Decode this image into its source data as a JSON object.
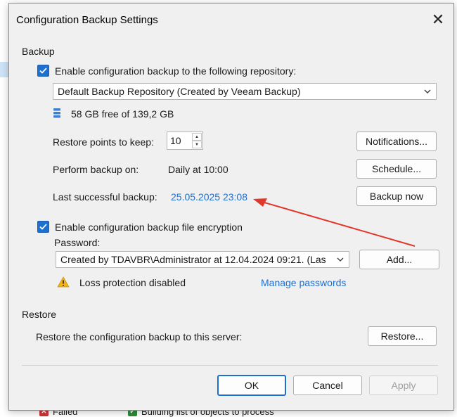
{
  "background": {
    "status_items": [
      {
        "label": "Failed",
        "icon": "error-icon",
        "color": "#d13438"
      },
      {
        "label": "Building list of objects to process",
        "icon": "success-icon",
        "color": "#2e8b3a"
      }
    ]
  },
  "dialog": {
    "title": "Configuration Backup Settings",
    "close_glyph": "✕",
    "backup": {
      "section_label": "Backup",
      "enable_backup_label": "Enable configuration backup to the following repository:",
      "enable_backup_checked": true,
      "repository": "Default Backup Repository (Created by Veeam Backup)",
      "storage_info": "58 GB free of 139,2 GB",
      "restore_points_label": "Restore points to keep:",
      "restore_points_value": "10",
      "notifications_button": "Notifications...",
      "perform_backup_label": "Perform backup on:",
      "perform_backup_value": "Daily at 10:00",
      "schedule_button": "Schedule...",
      "last_backup_label": "Last successful backup:",
      "last_backup_value": "25.05.2025 23:08",
      "backup_now_button": "Backup now",
      "encryption_label": "Enable configuration backup file encryption",
      "encryption_checked": true,
      "password_label": "Password:",
      "password_value": "Created by TDAVBR\\Administrator at 12.04.2024 09:21. (Las",
      "add_button": "Add...",
      "warning_text": "Loss protection disabled",
      "manage_passwords_link": "Manage passwords"
    },
    "restore": {
      "section_label": "Restore",
      "restore_label": "Restore the configuration backup to this server:",
      "restore_button": "Restore..."
    },
    "footer": {
      "ok_button": "OK",
      "cancel_button": "Cancel",
      "apply_button": "Apply"
    }
  },
  "colors": {
    "accent": "#1f6fcf",
    "link": "#1f6fcf",
    "annotation_arrow": "#e0392b",
    "warning": "#f2b418"
  }
}
